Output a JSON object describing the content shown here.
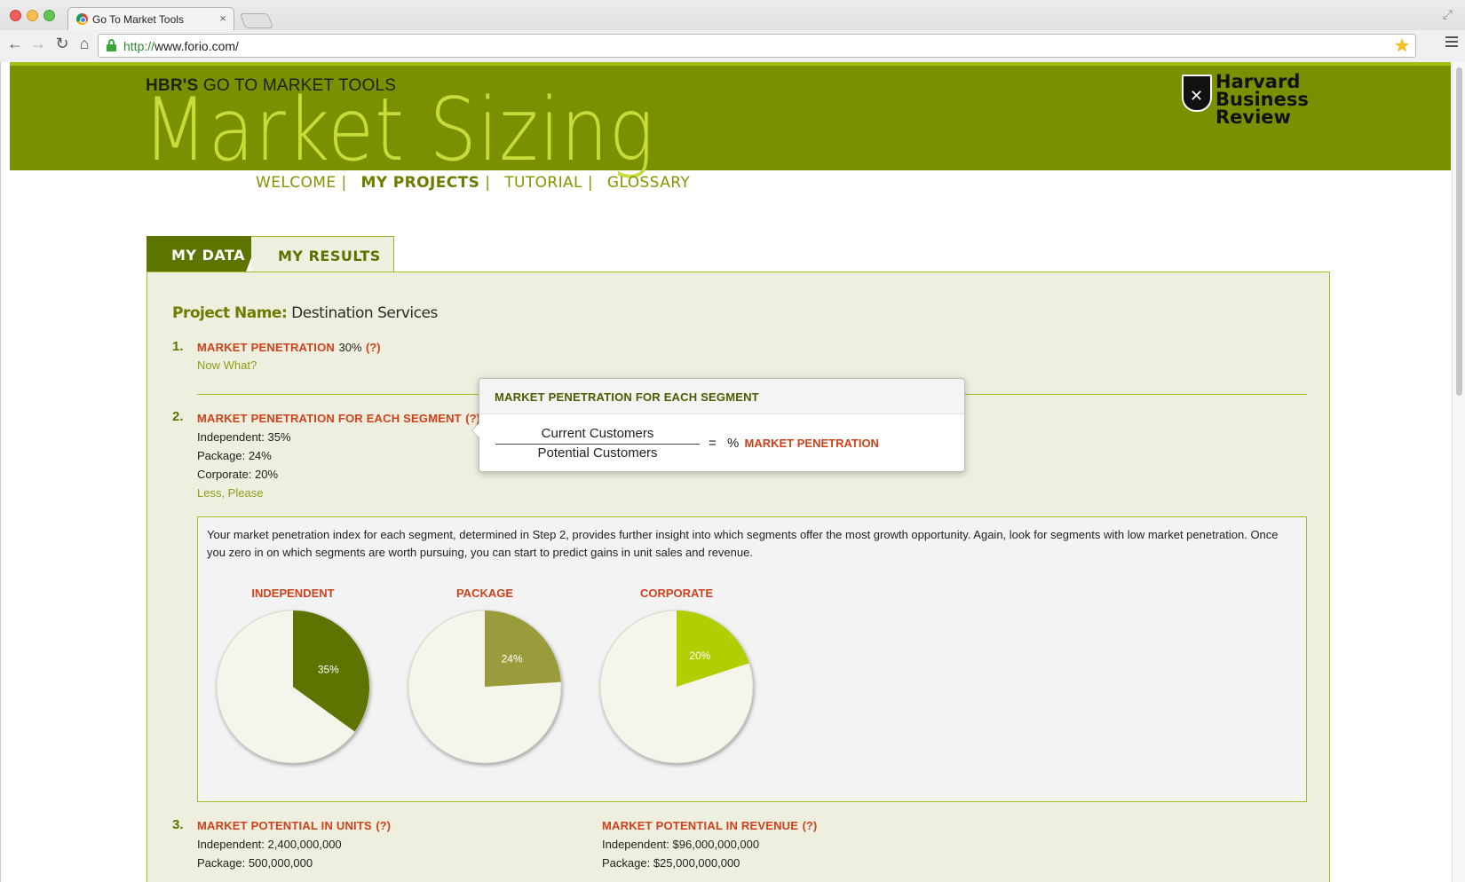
{
  "browser": {
    "tab_title": "Go To Market Tools",
    "tab_close": "×",
    "url_scheme": "http://",
    "url_rest": "www.forio.com/",
    "icons": [
      "back-icon",
      "forward-icon",
      "reload-icon",
      "home-icon",
      "lock-icon",
      "star-icon",
      "menu-icon"
    ]
  },
  "hero": {
    "kicker_brand": "HBR'S",
    "kicker_rest": "GO TO MARKET TOOLS",
    "title": "Market Sizing",
    "logo_lines": [
      "Harvard",
      "Business",
      "Review"
    ]
  },
  "nav": {
    "items": [
      {
        "label": "WELCOME"
      },
      {
        "label": "MY PROJECTS"
      },
      {
        "label": "TUTORIAL"
      },
      {
        "label": "GLOSSARY"
      }
    ],
    "separator": "|",
    "active_index": 1
  },
  "tabs": {
    "my_data": "MY DATA",
    "my_results": "MY RESULTS"
  },
  "project": {
    "label": "Project Name:",
    "value": "Destination Services"
  },
  "section1": {
    "number": "1.",
    "title": "MARKET PENETRATION",
    "value": "30%",
    "help": "(?)",
    "link": "Now What?"
  },
  "section2": {
    "number": "2.",
    "title": "MARKET PENETRATION FOR EACH SEGMENT",
    "help": "(?)",
    "lines": [
      "Independent: 35%",
      "Package: 24%",
      "Corporate: 20%"
    ],
    "link": "Less, Please",
    "info_text": "Your market penetration index for each segment, determined in Step 2, provides further insight into which segments offer the most growth opportunity. Again, look for segments with low market penetration. Once you zero in on which segments are worth pursuing, you can start to predict gains in unit sales and revenue."
  },
  "chart_data": {
    "type": "pie",
    "series": [
      {
        "name": "INDEPENDENT",
        "value": 35,
        "label": "35%",
        "color": "#5d7400"
      },
      {
        "name": "PACKAGE",
        "value": 24,
        "label": "24%",
        "color": "#9a9c3c"
      },
      {
        "name": "CORPORATE",
        "value": 20,
        "label": "20%",
        "color": "#b2cd00"
      }
    ],
    "remainder_color": "#f5f5ec"
  },
  "section3": {
    "number": "3.",
    "units_title": "MARKET POTENTIAL IN UNITS",
    "units_help": "(?)",
    "units_lines": [
      "Independent: 2,400,000,000",
      "Package: 500,000,000"
    ],
    "revenue_title": "MARKET POTENTIAL IN REVENUE",
    "revenue_help": "(?)",
    "revenue_lines": [
      "Independent: $96,000,000,000",
      "Package: $25,000,000,000"
    ]
  },
  "tooltip": {
    "title": "MARKET PENETRATION FOR EACH SEGMENT",
    "numerator": "Current Customers",
    "denominator": "Potential Customers",
    "equals": "=",
    "percent": "%",
    "result": "MARKET PENETRATION"
  }
}
